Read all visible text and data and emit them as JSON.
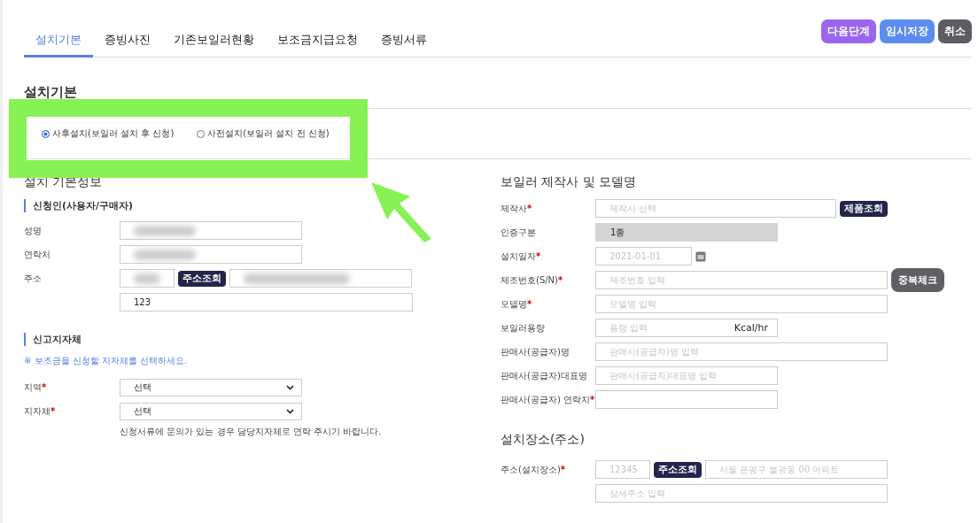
{
  "tabs": [
    {
      "label": "설치기본",
      "selected": true
    },
    {
      "label": "증빙사진",
      "selected": false
    },
    {
      "label": "기존보일러현황",
      "selected": false
    },
    {
      "label": "보조금지급요청",
      "selected": false
    },
    {
      "label": "증빙서류",
      "selected": false
    }
  ],
  "action_buttons": [
    {
      "label": "다음단계",
      "kind": "next"
    },
    {
      "label": "임시저장",
      "kind": "save"
    },
    {
      "label": "취소",
      "kind": "cancel"
    }
  ],
  "page_title": "설치기본",
  "install_types": [
    {
      "label": "사후설치(보일러 설치 후 신청)",
      "selected": true
    },
    {
      "label": "사전설치(보일러 설치 전 신청)",
      "selected": false
    }
  ],
  "basic_info": {
    "title": "설치 기본정보",
    "applicant": {
      "title": "신청인(사용자/구매자)",
      "fields": [
        {
          "label": "성명",
          "kind": "redacted"
        },
        {
          "label": "연락처",
          "kind": "redacted"
        },
        {
          "label": "주소",
          "kind": "address",
          "button": "주소조회",
          "detail_value": "123"
        }
      ]
    },
    "authority": {
      "title": "신고지자체",
      "note": "※ 보조금을 신청할 지자체를 선택하세요.",
      "selects": [
        {
          "label": "지역",
          "mark": "*",
          "value": "선택"
        },
        {
          "label": "지자체",
          "mark": "*",
          "value": "선택"
        }
      ],
      "help": "신청서류에 문의가 있는 경우 담당지자체로 연락 주시기 바랍니다."
    }
  },
  "boiler": {
    "title": "보일러 제작사 및 모델명",
    "fields": [
      {
        "label": "제작사",
        "mark": "*",
        "kind": "search",
        "placeholder": "제작사 선택",
        "button": "제품조회"
      },
      {
        "label": "인증구분",
        "kind": "readonly",
        "value": "1종"
      },
      {
        "label": "설치일자",
        "mark": "*",
        "kind": "date",
        "placeholder": "2021-01-01"
      },
      {
        "label": "제조번호(S/N)",
        "mark": "*",
        "kind": "check",
        "placeholder": "제조번호 입력",
        "button": "중복체크"
      },
      {
        "label": "모델명",
        "mark": "*",
        "kind": "wide",
        "placeholder": "모델명 입력"
      },
      {
        "label": "보일러용량",
        "kind": "unit",
        "placeholder": "용량 입력",
        "unit": "Kcal/hr"
      },
      {
        "label": "판매사(공급자)명",
        "kind": "wide",
        "placeholder": "판매사(공급자)명 입력"
      },
      {
        "label": "판매사(공급자)대표명",
        "kind": "short",
        "placeholder": "판매사(공급자)대표명 입력"
      },
      {
        "label": "판매사(공급자) 연락치",
        "mark": "*",
        "kind": "short"
      }
    ]
  },
  "site": {
    "title": "설치장소(주소)",
    "label": "주소(설치장소)",
    "mark": "*",
    "zip_placeholder": "12345",
    "button": "주소조회",
    "address_placeholder": "서울 은평구 불광동 00 아파트",
    "detail_placeholder": "상세주소 입력"
  }
}
